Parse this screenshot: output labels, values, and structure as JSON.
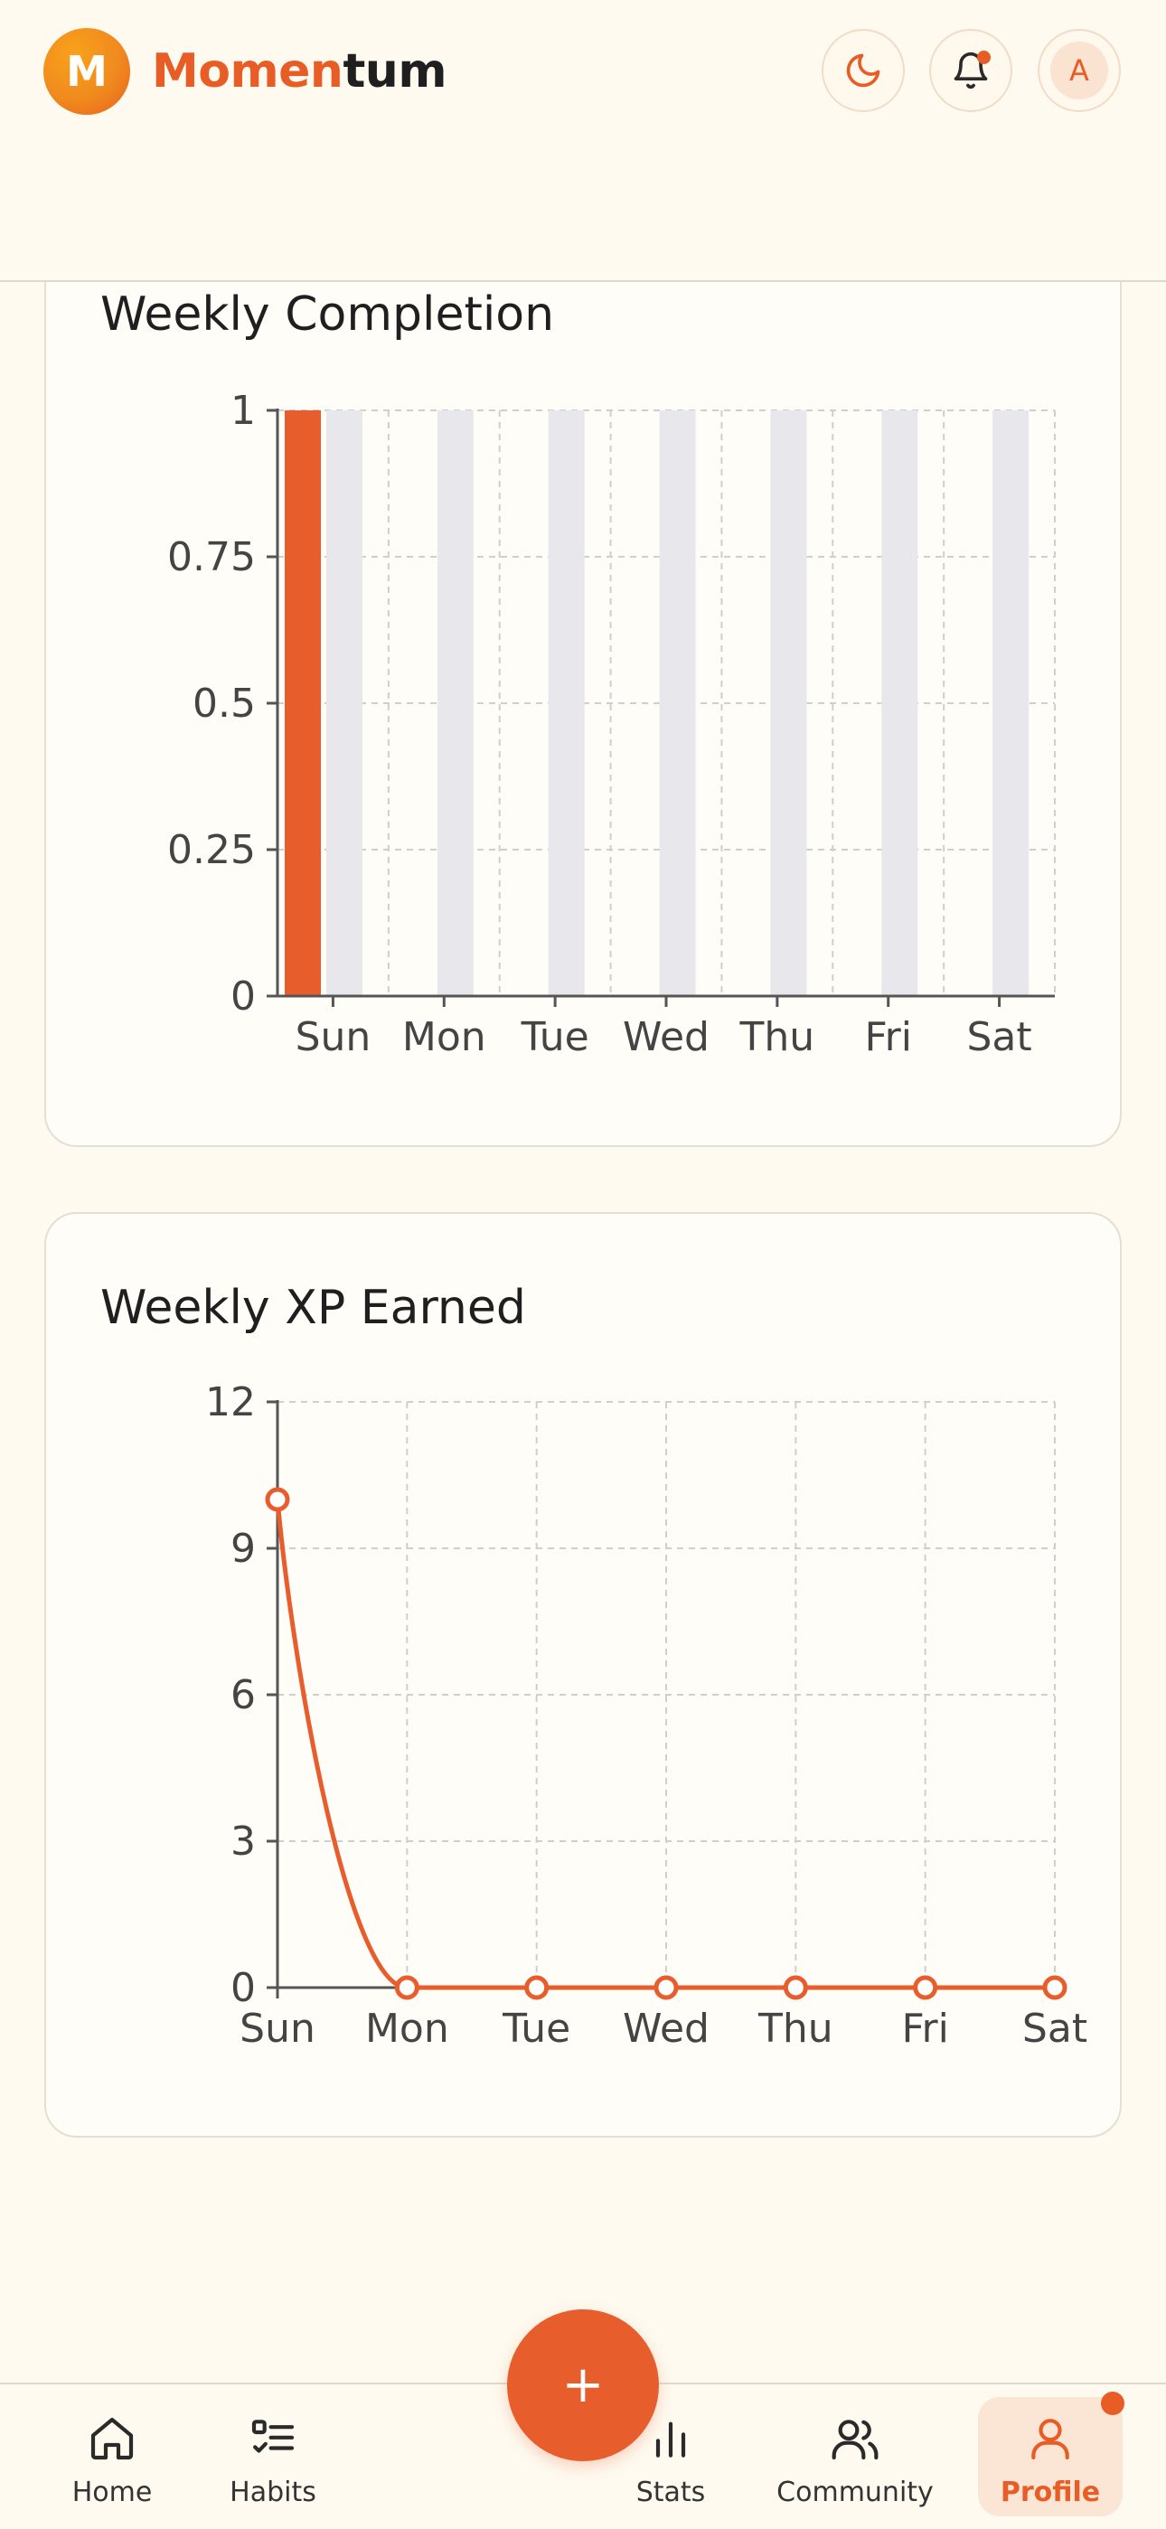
{
  "header": {
    "logo_letter": "M",
    "app_name_part1": "Momen",
    "app_name_part2": "tum",
    "avatar_letter": "A",
    "icons": [
      "moon-icon",
      "bell-icon"
    ],
    "bell_has_notification": true
  },
  "completion_card": {
    "title": "Weekly Completion"
  },
  "xp_card": {
    "title": "Weekly XP Earned"
  },
  "chart_data": [
    {
      "type": "bar",
      "title": "Weekly Completion",
      "categories": [
        "Sun",
        "Mon",
        "Tue",
        "Wed",
        "Thu",
        "Fri",
        "Sat"
      ],
      "series": [
        {
          "values": [
            1,
            0,
            0,
            0,
            0,
            0,
            0
          ],
          "color": "#e85d2c"
        },
        {
          "values": [
            1,
            1,
            1,
            1,
            1,
            1,
            1
          ],
          "color": "#e8e8ec"
        }
      ],
      "ylim": [
        0,
        1
      ],
      "yticks": [
        "0",
        "0.25",
        "0.5",
        "0.75",
        "1"
      ],
      "grid": true
    },
    {
      "type": "line",
      "title": "Weekly XP Earned",
      "categories": [
        "Sun",
        "Mon",
        "Tue",
        "Wed",
        "Thu",
        "Fri",
        "Sat"
      ],
      "series": [
        {
          "values": [
            10,
            0,
            0,
            0,
            0,
            0,
            0
          ],
          "color": "#e85d2c"
        }
      ],
      "ylim": [
        0,
        12
      ],
      "yticks": [
        "0",
        "3",
        "6",
        "9",
        "12"
      ],
      "grid": true
    }
  ],
  "fab": {
    "label": "+"
  },
  "bottom_nav": {
    "active": "Profile",
    "profile_has_notification": true,
    "items": [
      {
        "label": "Home",
        "icon": "home-icon"
      },
      {
        "label": "Habits",
        "icon": "checklist-icon"
      },
      {
        "label": "Stats",
        "icon": "bar-chart-icon"
      },
      {
        "label": "Community",
        "icon": "users-icon"
      },
      {
        "label": "Profile",
        "icon": "user-icon"
      }
    ]
  }
}
